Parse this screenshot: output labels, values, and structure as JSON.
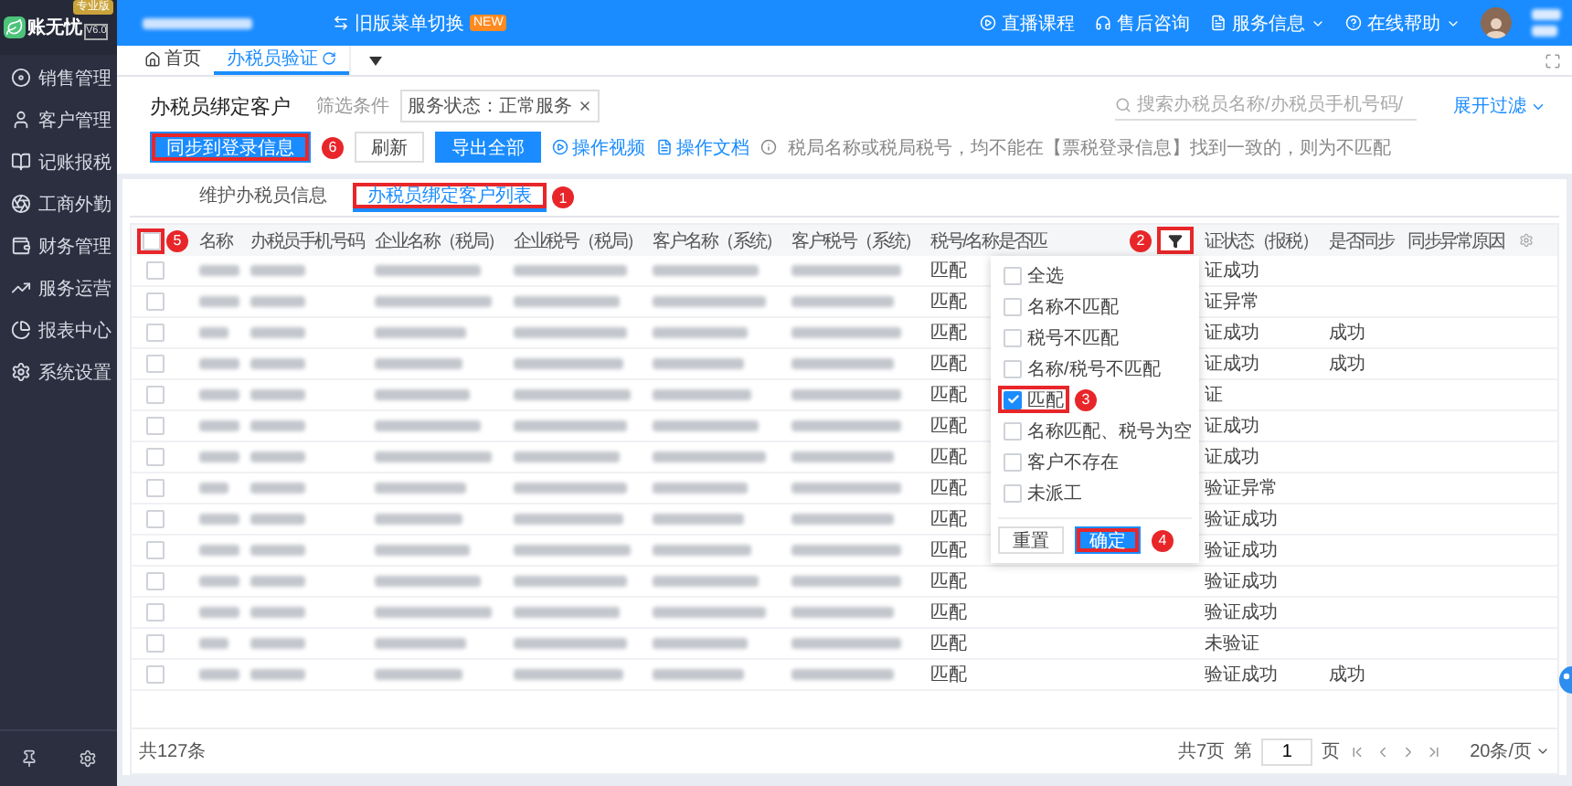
{
  "app": {
    "logo_name": "账无忧",
    "version": "V6.0",
    "edition": "专业版"
  },
  "sidebar": {
    "items": [
      {
        "label": "销售管理"
      },
      {
        "label": "客户管理"
      },
      {
        "label": "记账报税"
      },
      {
        "label": "工商外勤"
      },
      {
        "label": "财务管理"
      },
      {
        "label": "服务运营"
      },
      {
        "label": "报表中心"
      },
      {
        "label": "系统设置"
      }
    ]
  },
  "topbar": {
    "menu_switch": "旧版菜单切换",
    "new_badge": "NEW",
    "links": [
      {
        "label": "直播课程",
        "dropdown": false
      },
      {
        "label": "售后咨询",
        "dropdown": false
      },
      {
        "label": "服务信息",
        "dropdown": true
      },
      {
        "label": "在线帮助",
        "dropdown": true
      }
    ]
  },
  "page_tabs": [
    {
      "label": "首页",
      "selected": false
    },
    {
      "label": "办税员验证",
      "selected": true
    }
  ],
  "header": {
    "title": "办税员绑定客户",
    "filter_label": "筛选条件",
    "filter_tag": "服务状态：正常服务",
    "search": {
      "placeholder": "搜索办税员名称/办税员手机号码/"
    },
    "expand_filter": "展开过滤"
  },
  "actions": [
    {
      "label": "同步到登录信息",
      "kind": "primary",
      "callout": "6"
    },
    {
      "label": "刷新",
      "kind": "default"
    },
    {
      "label": "导出全部",
      "kind": "primary"
    },
    {
      "label": "操作视频",
      "kind": "video"
    },
    {
      "label": "操作文档",
      "kind": "doc"
    }
  ],
  "hint": "税局名称或税局税号，均不能在【票税登录信息】找到一致的，则为不匹配",
  "panel_tabs": [
    {
      "label": "维护办税员信息",
      "selected": false
    },
    {
      "label": "办税员绑定客户列表",
      "selected": true,
      "callout": "1"
    }
  ],
  "table": {
    "select_all_checked": false,
    "select_all_callout": "5",
    "filter_callout": "2",
    "columns": [
      "名称",
      "办税员手机号码",
      "企业名称（税局）",
      "企业税号（税局）",
      "客户名称（系统）",
      "客户税号（系统）",
      "税号/名称是否匹",
      "证状态（报税）",
      "是否同步",
      "同步异常原因"
    ],
    "rows": [
      {
        "checked": false,
        "match": "匹配",
        "status": "证成功"
      },
      {
        "checked": false,
        "match": "匹配",
        "status": "证异常"
      },
      {
        "checked": false,
        "match": "匹配",
        "status": "证成功",
        "sync": "成功"
      },
      {
        "checked": false,
        "match": "匹配",
        "status": "证成功",
        "sync": "成功"
      },
      {
        "checked": false,
        "match": "匹配",
        "status": "证"
      },
      {
        "checked": false,
        "match": "匹配",
        "status": "证成功"
      },
      {
        "checked": false,
        "match": "匹配",
        "status": "证成功"
      },
      {
        "checked": false,
        "match": "匹配",
        "status": "验证异常"
      },
      {
        "checked": false,
        "match": "匹配",
        "status": "验证成功"
      },
      {
        "checked": false,
        "match": "匹配",
        "status": "验证成功"
      },
      {
        "checked": false,
        "match": "匹配",
        "status": "验证成功"
      },
      {
        "checked": false,
        "match": "匹配",
        "status": "验证成功"
      },
      {
        "checked": false,
        "match": "匹配",
        "status": "未验证"
      },
      {
        "checked": false,
        "match": "匹配",
        "status": "验证成功",
        "sync": "成功"
      }
    ]
  },
  "filter_menu": {
    "options": [
      {
        "label": "全选",
        "checked": false
      },
      {
        "label": "名称不匹配",
        "checked": false
      },
      {
        "label": "税号不匹配",
        "checked": false
      },
      {
        "label": "名称/税号不匹配",
        "checked": false
      },
      {
        "label": "匹配",
        "checked": true,
        "callout": "3"
      },
      {
        "label": "名称匹配、税号为空",
        "checked": false
      },
      {
        "label": "客户不存在",
        "checked": false
      },
      {
        "label": "未派工",
        "checked": false
      }
    ],
    "reset": "重置",
    "confirm": "确定",
    "confirm_callout": "4"
  },
  "footer": {
    "total": "共127条",
    "pages": "共7页",
    "page_prefix": "第",
    "page": "1",
    "page_suffix": "页",
    "page_size": "20条/页"
  }
}
